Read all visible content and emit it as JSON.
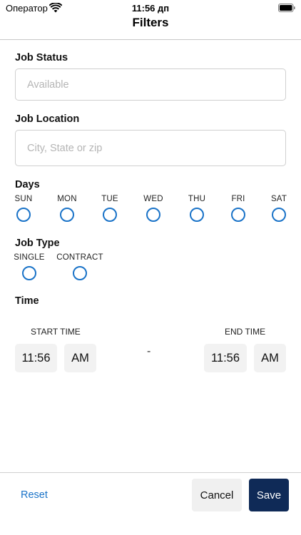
{
  "status_bar": {
    "carrier": "Оператор",
    "time": "11:56 дп"
  },
  "nav": {
    "title": "Filters"
  },
  "job_status": {
    "label": "Job Status",
    "placeholder": "Available",
    "value": ""
  },
  "job_location": {
    "label": "Job Location",
    "placeholder": "City, State or zip",
    "value": ""
  },
  "days": {
    "label": "Days",
    "items": [
      {
        "label": "SUN",
        "selected": false
      },
      {
        "label": "MON",
        "selected": false
      },
      {
        "label": "TUE",
        "selected": false
      },
      {
        "label": "WED",
        "selected": false
      },
      {
        "label": "THU",
        "selected": false
      },
      {
        "label": "FRI",
        "selected": false
      },
      {
        "label": "SAT",
        "selected": false
      }
    ]
  },
  "job_type": {
    "label": "Job Type",
    "items": [
      {
        "label": "SINGLE",
        "selected": false
      },
      {
        "label": "CONTRACT",
        "selected": false
      }
    ]
  },
  "time": {
    "label": "Time",
    "start_label": "START TIME",
    "end_label": "END TIME",
    "start_time": "11:56",
    "start_period": "AM",
    "separator": "-",
    "end_time": "11:56",
    "end_period": "AM"
  },
  "footer": {
    "reset_label": "Reset",
    "cancel_label": "Cancel",
    "save_label": "Save"
  },
  "colors": {
    "accent": "#1a73c8",
    "primary_button": "#0f2a57"
  }
}
